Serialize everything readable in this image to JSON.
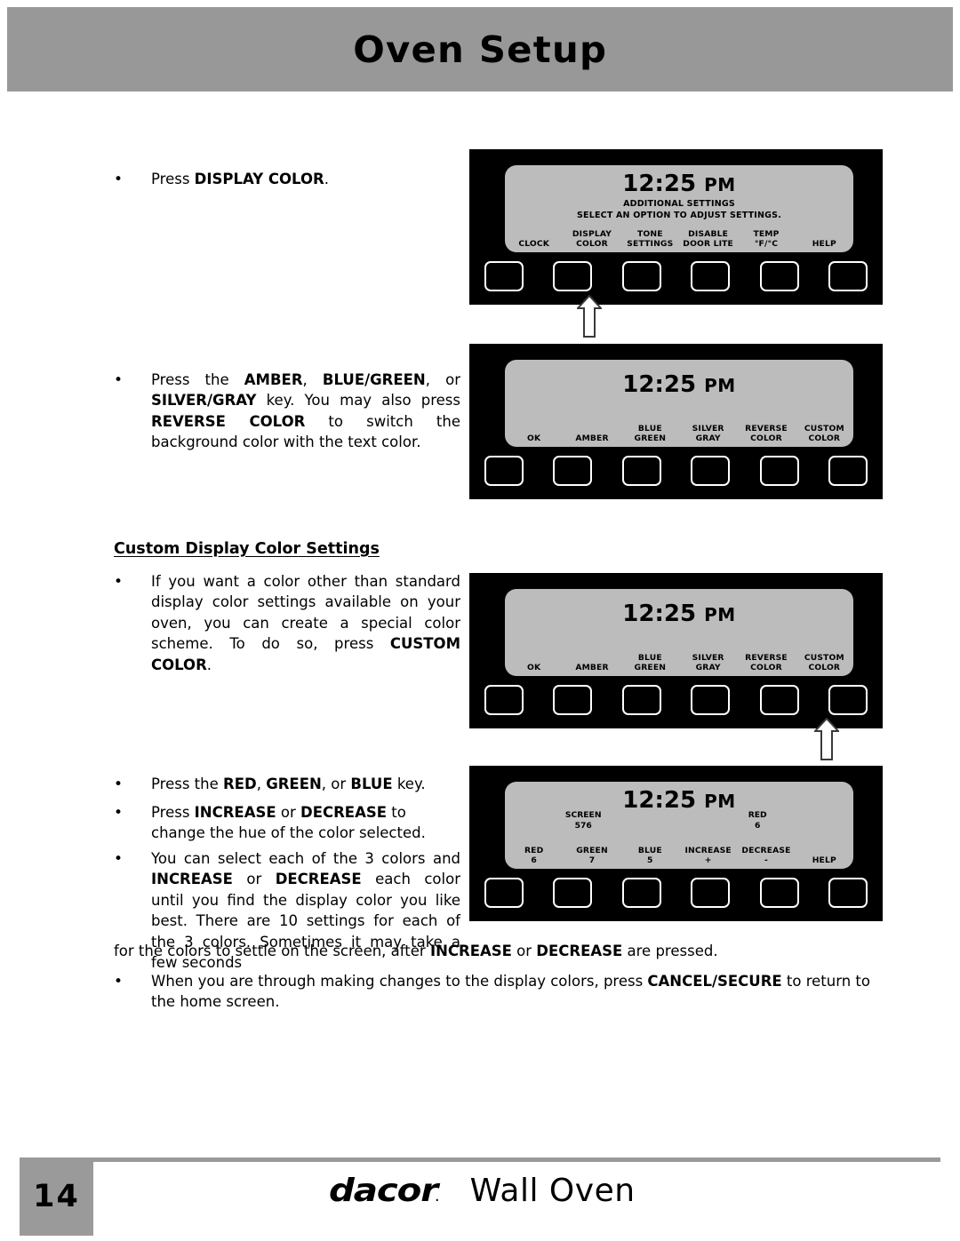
{
  "header": {
    "title": "Oven Setup"
  },
  "footer": {
    "page_number": "14",
    "brand": "dacor",
    "brand_dot": ".",
    "product": "Wall Oven"
  },
  "section_heading": "Custom Display Color Settings",
  "body": {
    "bullet_glyph": "•",
    "b1_part1": "Press ",
    "b1_bold1": "DISPLAY COLOR",
    "b1_part2": ".",
    "b2_part1": "Press the ",
    "b2_bold1": "AMBER",
    "b2_part2": ", ",
    "b2_bold2": "BLUE/GREEN",
    "b2_part3": ", or ",
    "b2_bold3": "SILVER/GRAY",
    "b2_part4": " key. You may also press ",
    "b2_bold4": "REVERSE COLOR",
    "b2_part5": " to switch the background color with the text color.",
    "b3_part1": "If you want a color other than standard display color settings available on your oven, you can create a special color scheme. To do so, press ",
    "b3_bold1": "CUSTOM COLOR",
    "b3_part2": ".",
    "b4_part1": "Press the ",
    "b4_bold1": "RED",
    "b4_part2": ", ",
    "b4_bold2": "GREEN",
    "b4_part3": ", or ",
    "b4_bold3": "BLUE",
    "b4_part4": " key.",
    "b5_part1": "Press ",
    "b5_bold1": "INCREASE",
    "b5_part2": " or ",
    "b5_bold2": "DECREASE",
    "b5_part3": " to change the hue of the color selected.",
    "b6_part1": "You can select each of the 3 colors and ",
    "b6_bold1": "INCREASE",
    "b6_part2": " or ",
    "b6_bold2": "DECREASE",
    "b6_part3": " each color until you find the display color you like best. There are 10 settings for each of the 3 colors. Sometimes it may take a few seconds",
    "b6_cont_part1": "for the colors to settle on the screen, after ",
    "b6_cont_bold1": "INCREASE",
    "b6_cont_part2": " or ",
    "b6_cont_bold2": "DECREASE",
    "b6_cont_part3": " are pressed.",
    "b7_part1": "When you are through making changes to the display colors, press ",
    "b7_bold1": "CANCEL/SECURE",
    "b7_part2": " to return to the home screen."
  },
  "panels": [
    {
      "id": "panel-additional-settings",
      "time": "12:25",
      "ampm": "PM",
      "sub_line1": "ADDITIONAL SETTINGS",
      "sub_line2": "SELECT AN OPTION TO ADJUST SETTINGS.",
      "labels": [
        {
          "line1": "",
          "line2": "CLOCK"
        },
        {
          "line1": "DISPLAY",
          "line2": "COLOR"
        },
        {
          "line1": "TONE",
          "line2": "SETTINGS"
        },
        {
          "line1": "DISABLE",
          "line2": "DOOR LITE"
        },
        {
          "line1": "TEMP",
          "line2": "°F/°C"
        },
        {
          "line1": "",
          "line2": "HELP"
        }
      ],
      "arrow_target_index": 1
    },
    {
      "id": "panel-display-color",
      "time": "12:25",
      "ampm": "PM",
      "labels": [
        {
          "line1": "",
          "line2": "OK"
        },
        {
          "line1": "",
          "line2": "AMBER"
        },
        {
          "line1": "BLUE",
          "line2": "GREEN"
        },
        {
          "line1": "SILVER",
          "line2": "GRAY"
        },
        {
          "line1": "REVERSE",
          "line2": "COLOR"
        },
        {
          "line1": "CUSTOM",
          "line2": "COLOR"
        }
      ]
    },
    {
      "id": "panel-display-color-2",
      "time": "12:25",
      "ampm": "PM",
      "labels": [
        {
          "line1": "",
          "line2": "OK"
        },
        {
          "line1": "",
          "line2": "AMBER"
        },
        {
          "line1": "BLUE",
          "line2": "GREEN"
        },
        {
          "line1": "SILVER",
          "line2": "GRAY"
        },
        {
          "line1": "REVERSE",
          "line2": "COLOR"
        },
        {
          "line1": "CUSTOM",
          "line2": "COLOR"
        }
      ],
      "arrow_target_index": 5
    },
    {
      "id": "panel-custom-color",
      "time": "12:25",
      "ampm": "PM",
      "readouts": [
        {
          "name": "SCREEN",
          "value": "576"
        },
        {
          "name": "RED",
          "value": "6"
        }
      ],
      "labels": [
        {
          "line1": "RED",
          "line2": "6"
        },
        {
          "line1": "GREEN",
          "line2": "7"
        },
        {
          "line1": "BLUE",
          "line2": "5"
        },
        {
          "line1": "INCREASE",
          "line2": "+"
        },
        {
          "line1": "DECREASE",
          "line2": "-"
        },
        {
          "line1": "",
          "line2": "HELP"
        }
      ]
    }
  ],
  "colors": {
    "header_gray": "#989898",
    "lcd_gray": "#bcbcbc",
    "panel_black": "#000000",
    "footer_gray": "#9a9a9a"
  }
}
